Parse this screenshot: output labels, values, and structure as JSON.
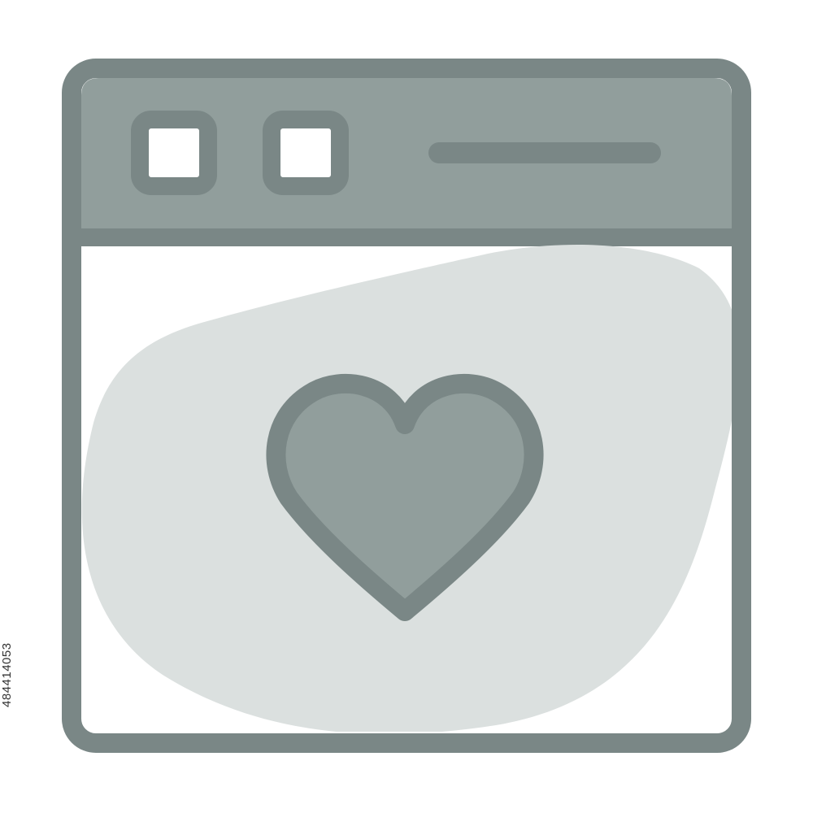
{
  "icon": {
    "name": "browser-favorite-icon",
    "parts": [
      "window-frame",
      "title-bar",
      "control-squares",
      "address-bar-line",
      "background-blob",
      "heart-icon"
    ]
  },
  "colors": {
    "stroke": "#7a8786",
    "title_bar_fill": "#919e9c",
    "heart_fill": "#919e9c",
    "blob_fill": "#dbe0df",
    "window_fill": "#ffffff",
    "page_background": "#ffffff"
  },
  "stock_id": "484414053"
}
